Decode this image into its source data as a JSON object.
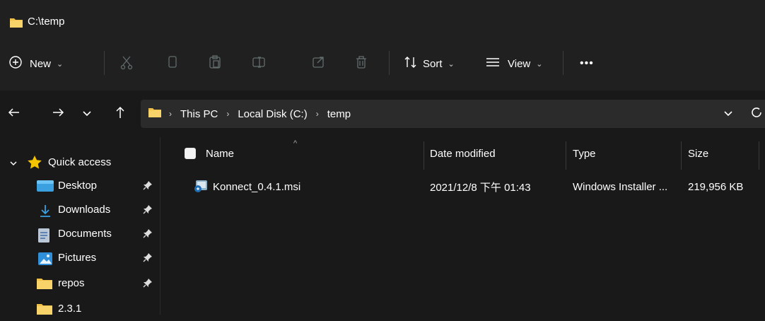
{
  "window": {
    "title": "C:\\temp"
  },
  "commandbar": {
    "new_label": "New",
    "sort_label": "Sort",
    "view_label": "View",
    "more_label": "•••"
  },
  "address": {
    "crumbs": [
      "This PC",
      "Local Disk (C:)",
      "temp"
    ]
  },
  "sidebar": {
    "quick_access_label": "Quick access",
    "items": [
      {
        "label": "Desktop",
        "icon": "desktop-icon",
        "pinned": true
      },
      {
        "label": "Downloads",
        "icon": "download-icon",
        "pinned": true
      },
      {
        "label": "Documents",
        "icon": "document-icon",
        "pinned": true
      },
      {
        "label": "Pictures",
        "icon": "pictures-icon",
        "pinned": true
      },
      {
        "label": "repos",
        "icon": "folder-icon",
        "pinned": true
      },
      {
        "label": "2.3.1",
        "icon": "folder-icon",
        "pinned": false
      }
    ]
  },
  "columns": {
    "name": "Name",
    "date": "Date modified",
    "type": "Type",
    "size": "Size"
  },
  "files": [
    {
      "name": "Konnect_0.4.1.msi",
      "date": "2021/12/8 下午 01:43",
      "type": "Windows Installer ...",
      "size": "219,956 KB",
      "icon": "installer-icon"
    }
  ],
  "colors": {
    "background": "#191919",
    "chrome": "#202020",
    "address": "#2b2b2b",
    "folder": "#f0c24b",
    "accent_star": "#f5c400"
  }
}
